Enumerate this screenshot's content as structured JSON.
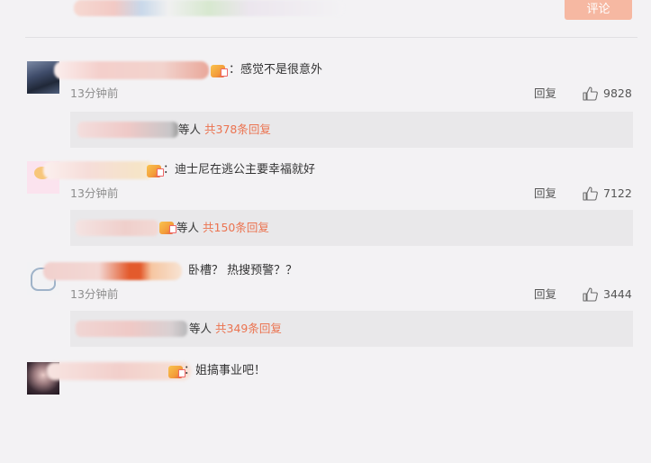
{
  "submit_label": "评论",
  "comments": [
    {
      "text": "：感觉不是很意外",
      "time": "13分钟前",
      "reply": "回复",
      "likes": "9828",
      "sub_who": "等人",
      "sub_link": "共378条回复"
    },
    {
      "text": "：迪士尼在逃公主要幸福就好",
      "time": "13分钟前",
      "reply": "回复",
      "likes": "7122",
      "sub_who": "等人",
      "sub_link": "共150条回复"
    },
    {
      "text": "卧槽？ 热搜预警？？",
      "time": "13分钟前",
      "reply": "回复",
      "likes": "3444",
      "sub_who": "等人",
      "sub_link": "共349条回复"
    },
    {
      "text": "：姐搞事业吧！"
    }
  ]
}
